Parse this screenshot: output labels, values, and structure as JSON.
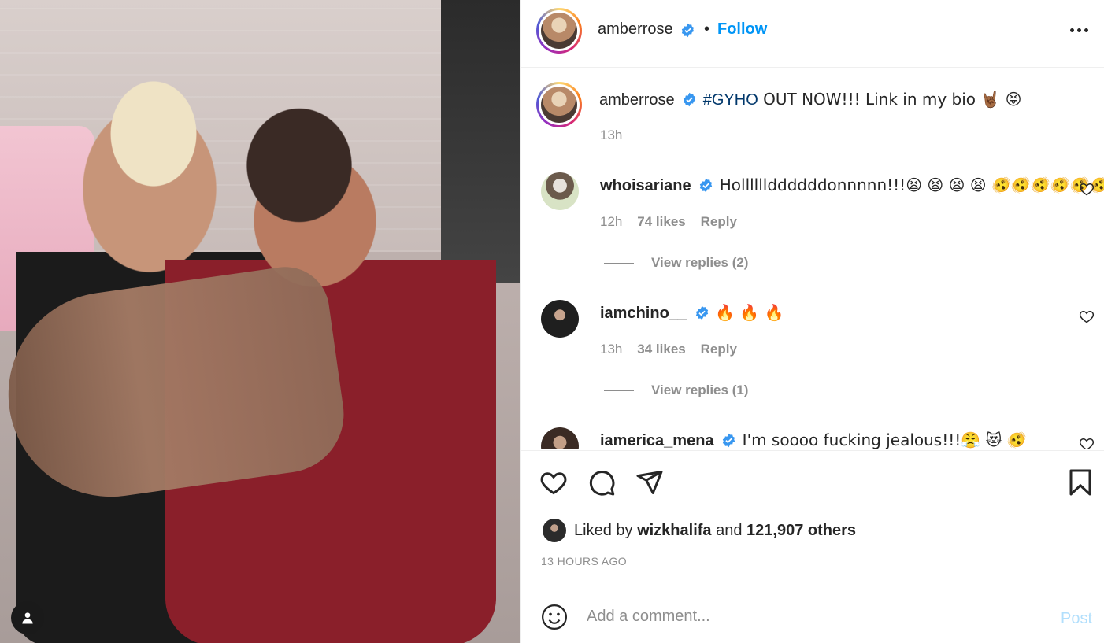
{
  "post": {
    "author": "amberrose",
    "follow_label": "Follow",
    "separator": "•",
    "caption": {
      "hashtag": "#GYHO",
      "text": " OUT NOW!!! Link in my bio 🤘🏾 😝",
      "time": "13h"
    }
  },
  "comments": [
    {
      "username": "whoisariane",
      "verified": true,
      "text": "Hollllllddddddonnnnn!!!😫 😫 😫 😫 🫨🫨🫨🫨🫨🫨🫨🫨",
      "time": "12h",
      "likes": "74 likes",
      "reply_label": "Reply",
      "view_replies": "View replies (2)"
    },
    {
      "username": "iamchino__",
      "verified": true,
      "text": "🔥 🔥 🔥",
      "time": "13h",
      "likes": "34 likes",
      "reply_label": "Reply",
      "view_replies": "View replies (1)"
    },
    {
      "username": "iamerica_mena",
      "verified": true,
      "text": "I'm soooo fucking jealous!!!😤 😻 🫨"
    }
  ],
  "likes": {
    "prefix": "Liked by",
    "user": "wizkhalifa",
    "and": "and",
    "others": "121,907 others"
  },
  "time_ago": "13 HOURS AGO",
  "add_comment": {
    "placeholder": "Add a comment...",
    "post_label": "Post"
  },
  "colors": {
    "accent": "#0095f6",
    "verified": "#3897f0",
    "post_disabled": "#b2dffc"
  },
  "icons": [
    "user-tag-icon",
    "verified-icon",
    "more-icon",
    "heart-icon",
    "comment-icon",
    "share-icon",
    "bookmark-icon",
    "emoji-icon"
  ]
}
